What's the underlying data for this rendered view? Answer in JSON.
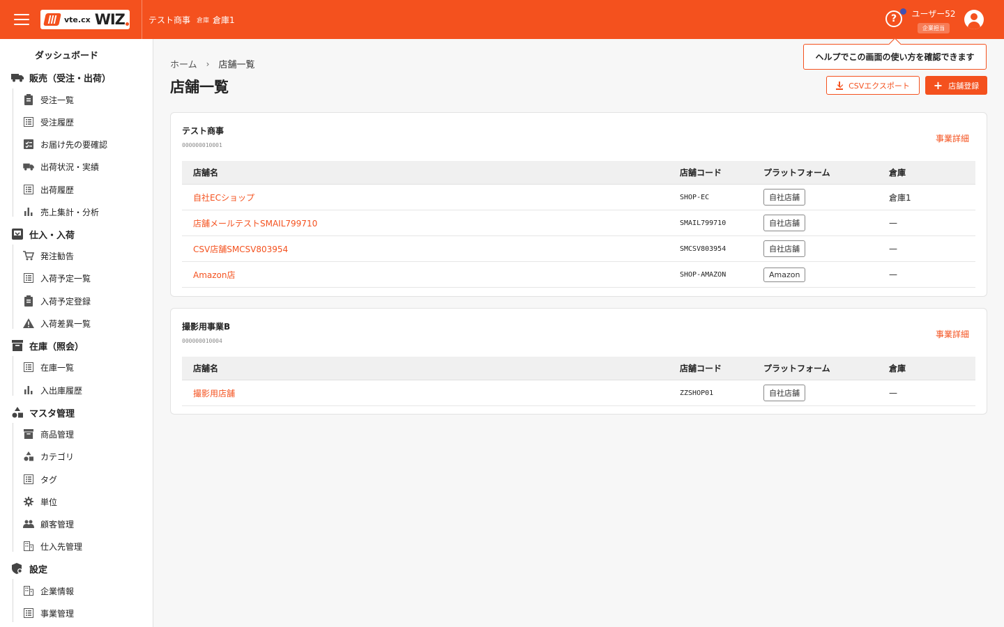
{
  "header": {
    "logo_small": "vte.cx",
    "logo_big": "WIZ",
    "company": "テスト商事",
    "warehouse_label": "倉庫",
    "warehouse_name": "倉庫1",
    "user_name": "ユーザー52",
    "user_role": "企業担当",
    "help_glyph": "?"
  },
  "tooltip": "ヘルプでこの画面の使い方を確認できます",
  "sidebar": {
    "dashboard": "ダッシュボード",
    "sales": {
      "label": "販売（受注・出荷）",
      "items": [
        "受注一覧",
        "受注履歴",
        "お届け先の要確認",
        "出荷状況・実績",
        "出荷履歴",
        "売上集計・分析"
      ]
    },
    "purchase": {
      "label": "仕入・入荷",
      "items": [
        "発注勧告",
        "入荷予定一覧",
        "入荷予定登録",
        "入荷差異一覧"
      ]
    },
    "stock": {
      "label": "在庫（照会）",
      "items": [
        "在庫一覧",
        "入出庫履歴"
      ]
    },
    "master": {
      "label": "マスタ管理",
      "items": [
        "商品管理",
        "カテゴリ",
        "タグ",
        "単位",
        "顧客管理",
        "仕入先管理"
      ]
    },
    "settings": {
      "label": "設定",
      "items": [
        "企業情報",
        "事業管理"
      ]
    }
  },
  "breadcrumb": {
    "home": "ホーム",
    "sep": "›",
    "current": "店舗一覧"
  },
  "page_title": "店舗一覧",
  "buttons": {
    "csv_export": "CSVエクスポート",
    "add_store": "店舗登録",
    "plus": "+"
  },
  "table_headers": {
    "name": "店舗名",
    "code": "店舗コード",
    "platform": "プラットフォーム",
    "warehouse": "倉庫"
  },
  "businesses": [
    {
      "name": "テスト商事",
      "code": "000000010001",
      "link": "事業詳細",
      "stores": [
        {
          "name": "自社ECショップ",
          "code": "SHOP-EC",
          "platform": "自社店舗",
          "warehouse": "倉庫1"
        },
        {
          "name": "店舗メールテストSMAIL799710",
          "code": "SMAIL799710",
          "platform": "自社店舗",
          "warehouse": "—"
        },
        {
          "name": "CSV店舗SMCSV803954",
          "code": "SMCSV803954",
          "platform": "自社店舗",
          "warehouse": "—"
        },
        {
          "name": "Amazon店",
          "code": "SHOP-AMAZON",
          "platform": "Amazon",
          "warehouse": "—"
        }
      ]
    },
    {
      "name": "撮影用事業B",
      "code": "000000010004",
      "link": "事業詳細",
      "stores": [
        {
          "name": "撮影用店舗",
          "code": "ZZSHOP01",
          "platform": "自社店舗",
          "warehouse": "—"
        }
      ]
    }
  ],
  "colors": {
    "accent": "#f4511e",
    "badge": "#3f51b5"
  }
}
